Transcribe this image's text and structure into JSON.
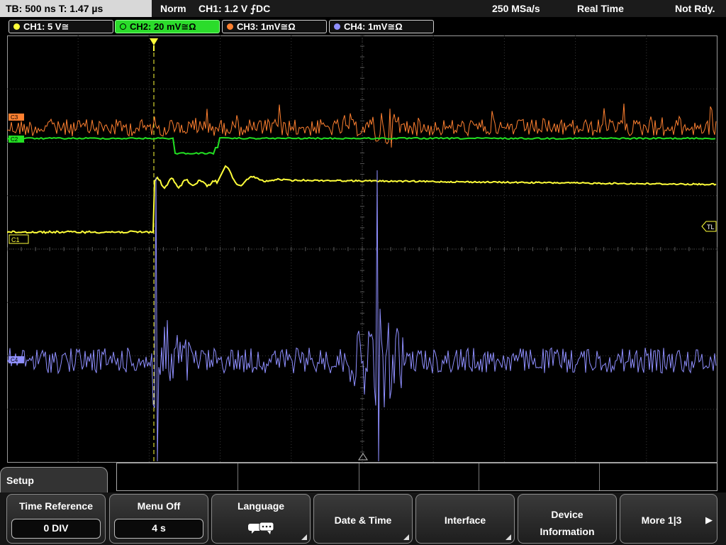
{
  "top_bar": {
    "timebase": "TB: 500 ns   T: 1.47 µs",
    "trigger_mode": "Norm",
    "trigger_info": "CH1: 1.2 V ⨍DC",
    "sample_rate": "250 MSa/s",
    "acq_mode": "Real Time",
    "status": "Not Rdy."
  },
  "channels": [
    {
      "label": "CH1: 5 V≅",
      "color": "#ffff3a"
    },
    {
      "label": "CH2: 20 mV≅Ω",
      "color": "#22e022"
    },
    {
      "label": "CH3: 1mV≅Ω",
      "color": "#ff8030"
    },
    {
      "label": "CH4: 1mV≅Ω",
      "color": "#8f8fff"
    }
  ],
  "screen": {
    "marker_c1": "C1",
    "marker_tl": "TL",
    "marker_c2": "C2",
    "marker_c3": "C3",
    "marker_c4": "C4"
  },
  "setup_tab": {
    "title": "Setup"
  },
  "softkeys": {
    "time_reference": {
      "label": "Time Reference",
      "value": "0 DIV"
    },
    "menu_off": {
      "label": "Menu Off",
      "value": "4 s"
    },
    "language": {
      "label": "Language"
    },
    "date_time": {
      "label": "Date & Time"
    },
    "interface": {
      "label": "Interface"
    },
    "device_info": {
      "line1": "Device",
      "line2": "Information"
    },
    "more": {
      "label": "More 1|3",
      "arrow": "▶"
    }
  }
}
